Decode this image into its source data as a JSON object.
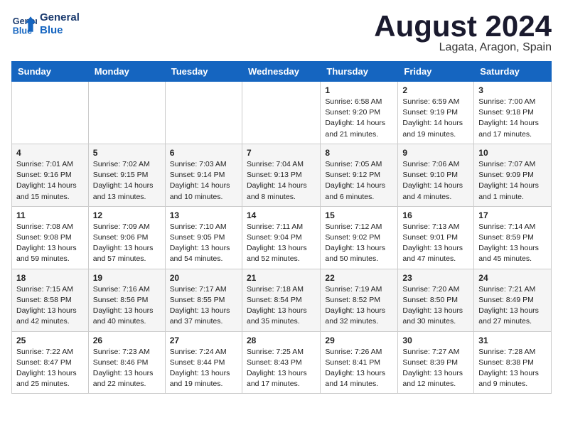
{
  "header": {
    "logo_line1": "General",
    "logo_line2": "Blue",
    "month_title": "August 2024",
    "location": "Lagata, Aragon, Spain"
  },
  "weekdays": [
    "Sunday",
    "Monday",
    "Tuesday",
    "Wednesday",
    "Thursday",
    "Friday",
    "Saturday"
  ],
  "weeks": [
    [
      {
        "day": "",
        "info": ""
      },
      {
        "day": "",
        "info": ""
      },
      {
        "day": "",
        "info": ""
      },
      {
        "day": "",
        "info": ""
      },
      {
        "day": "1",
        "info": "Sunrise: 6:58 AM\nSunset: 9:20 PM\nDaylight: 14 hours\nand 21 minutes."
      },
      {
        "day": "2",
        "info": "Sunrise: 6:59 AM\nSunset: 9:19 PM\nDaylight: 14 hours\nand 19 minutes."
      },
      {
        "day": "3",
        "info": "Sunrise: 7:00 AM\nSunset: 9:18 PM\nDaylight: 14 hours\nand 17 minutes."
      }
    ],
    [
      {
        "day": "4",
        "info": "Sunrise: 7:01 AM\nSunset: 9:16 PM\nDaylight: 14 hours\nand 15 minutes."
      },
      {
        "day": "5",
        "info": "Sunrise: 7:02 AM\nSunset: 9:15 PM\nDaylight: 14 hours\nand 13 minutes."
      },
      {
        "day": "6",
        "info": "Sunrise: 7:03 AM\nSunset: 9:14 PM\nDaylight: 14 hours\nand 10 minutes."
      },
      {
        "day": "7",
        "info": "Sunrise: 7:04 AM\nSunset: 9:13 PM\nDaylight: 14 hours\nand 8 minutes."
      },
      {
        "day": "8",
        "info": "Sunrise: 7:05 AM\nSunset: 9:12 PM\nDaylight: 14 hours\nand 6 minutes."
      },
      {
        "day": "9",
        "info": "Sunrise: 7:06 AM\nSunset: 9:10 PM\nDaylight: 14 hours\nand 4 minutes."
      },
      {
        "day": "10",
        "info": "Sunrise: 7:07 AM\nSunset: 9:09 PM\nDaylight: 14 hours\nand 1 minute."
      }
    ],
    [
      {
        "day": "11",
        "info": "Sunrise: 7:08 AM\nSunset: 9:08 PM\nDaylight: 13 hours\nand 59 minutes."
      },
      {
        "day": "12",
        "info": "Sunrise: 7:09 AM\nSunset: 9:06 PM\nDaylight: 13 hours\nand 57 minutes."
      },
      {
        "day": "13",
        "info": "Sunrise: 7:10 AM\nSunset: 9:05 PM\nDaylight: 13 hours\nand 54 minutes."
      },
      {
        "day": "14",
        "info": "Sunrise: 7:11 AM\nSunset: 9:04 PM\nDaylight: 13 hours\nand 52 minutes."
      },
      {
        "day": "15",
        "info": "Sunrise: 7:12 AM\nSunset: 9:02 PM\nDaylight: 13 hours\nand 50 minutes."
      },
      {
        "day": "16",
        "info": "Sunrise: 7:13 AM\nSunset: 9:01 PM\nDaylight: 13 hours\nand 47 minutes."
      },
      {
        "day": "17",
        "info": "Sunrise: 7:14 AM\nSunset: 8:59 PM\nDaylight: 13 hours\nand 45 minutes."
      }
    ],
    [
      {
        "day": "18",
        "info": "Sunrise: 7:15 AM\nSunset: 8:58 PM\nDaylight: 13 hours\nand 42 minutes."
      },
      {
        "day": "19",
        "info": "Sunrise: 7:16 AM\nSunset: 8:56 PM\nDaylight: 13 hours\nand 40 minutes."
      },
      {
        "day": "20",
        "info": "Sunrise: 7:17 AM\nSunset: 8:55 PM\nDaylight: 13 hours\nand 37 minutes."
      },
      {
        "day": "21",
        "info": "Sunrise: 7:18 AM\nSunset: 8:54 PM\nDaylight: 13 hours\nand 35 minutes."
      },
      {
        "day": "22",
        "info": "Sunrise: 7:19 AM\nSunset: 8:52 PM\nDaylight: 13 hours\nand 32 minutes."
      },
      {
        "day": "23",
        "info": "Sunrise: 7:20 AM\nSunset: 8:50 PM\nDaylight: 13 hours\nand 30 minutes."
      },
      {
        "day": "24",
        "info": "Sunrise: 7:21 AM\nSunset: 8:49 PM\nDaylight: 13 hours\nand 27 minutes."
      }
    ],
    [
      {
        "day": "25",
        "info": "Sunrise: 7:22 AM\nSunset: 8:47 PM\nDaylight: 13 hours\nand 25 minutes."
      },
      {
        "day": "26",
        "info": "Sunrise: 7:23 AM\nSunset: 8:46 PM\nDaylight: 13 hours\nand 22 minutes."
      },
      {
        "day": "27",
        "info": "Sunrise: 7:24 AM\nSunset: 8:44 PM\nDaylight: 13 hours\nand 19 minutes."
      },
      {
        "day": "28",
        "info": "Sunrise: 7:25 AM\nSunset: 8:43 PM\nDaylight: 13 hours\nand 17 minutes."
      },
      {
        "day": "29",
        "info": "Sunrise: 7:26 AM\nSunset: 8:41 PM\nDaylight: 13 hours\nand 14 minutes."
      },
      {
        "day": "30",
        "info": "Sunrise: 7:27 AM\nSunset: 8:39 PM\nDaylight: 13 hours\nand 12 minutes."
      },
      {
        "day": "31",
        "info": "Sunrise: 7:28 AM\nSunset: 8:38 PM\nDaylight: 13 hours\nand 9 minutes."
      }
    ]
  ]
}
